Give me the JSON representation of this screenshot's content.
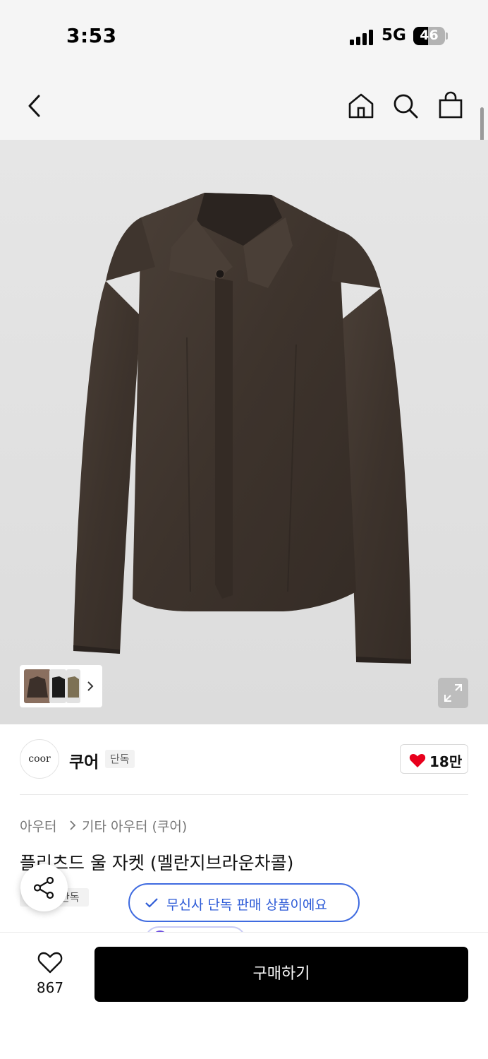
{
  "status_bar": {
    "time": "3:53",
    "network": "5G",
    "battery": "46",
    "battery_level": 0.46
  },
  "header": {
    "back_icon": "chevron-left-icon",
    "home_icon": "home-icon",
    "search_icon": "search-icon",
    "cart_icon": "shopping-bag-icon"
  },
  "gallery": {
    "image": "dark brown wool jacket",
    "thumbnails": [
      "brown-jacket",
      "black-jacket",
      "khaki-jacket"
    ],
    "more_icon": "chevron-right-icon",
    "expand_icon": "expand-icon"
  },
  "brand": {
    "logo_text": "coor",
    "name": "쿠어",
    "tag": "단독",
    "likes": "18만",
    "heart_color": "#e8001c"
  },
  "product": {
    "breadcrumb": [
      "아우터",
      "기타 아우터 (쿠어)"
    ],
    "title": "플리츠드 울 자켓 (멜란지브라운차콜)",
    "tag": "단독",
    "exclusive_notice": "무신사 단독 판매 상품이에요"
  },
  "bottom_bar": {
    "wish_count": "867",
    "buy_label": "구매하기"
  }
}
